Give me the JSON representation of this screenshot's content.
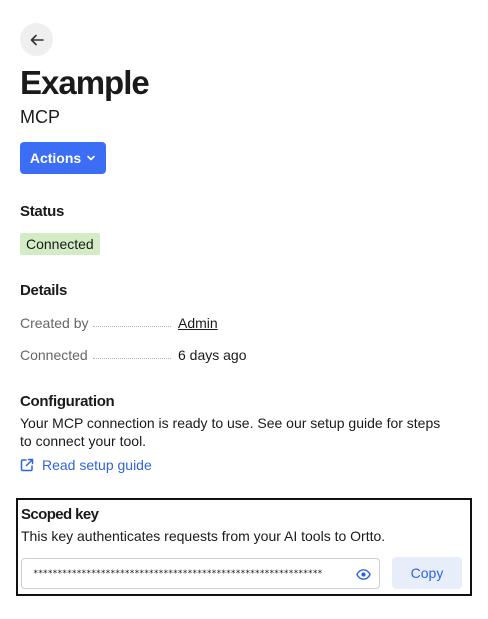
{
  "header": {
    "back_icon": "arrow-left-icon",
    "title": "Example",
    "subtitle": "MCP",
    "actions_label": "Actions",
    "actions_icon": "chevron-down-icon"
  },
  "status": {
    "heading": "Status",
    "badge": "Connected",
    "badge_color": "#d4ecc6"
  },
  "details": {
    "heading": "Details",
    "rows": [
      {
        "label": "Created by",
        "value": "Admin"
      },
      {
        "label": "Connected",
        "value": "6 days ago"
      }
    ]
  },
  "configuration": {
    "heading": "Configuration",
    "text": "Your MCP connection is ready to use. See our setup guide for steps to connect your tool.",
    "link_label": "Read setup guide",
    "link_icon": "external-link-icon"
  },
  "scoped_key": {
    "heading": "Scoped key",
    "description": "This key authenticates requests from your AI tools to Ortto.",
    "masked_value": "************************************************************",
    "reveal_icon": "eye-icon",
    "copy_label": "Copy"
  },
  "colors": {
    "primary": "#3b6ef5",
    "link": "#2f63e0",
    "copy_bg": "#e8eef9"
  }
}
